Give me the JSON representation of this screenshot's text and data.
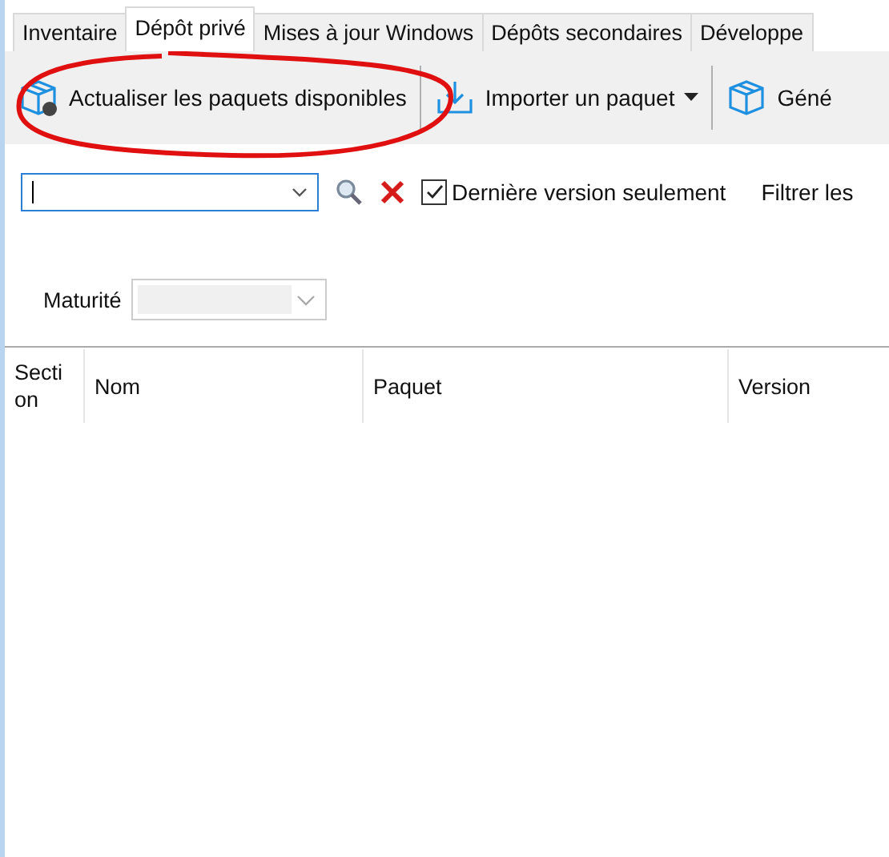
{
  "tabs": [
    {
      "label": "Inventaire",
      "selected": false
    },
    {
      "label": "Dépôt privé",
      "selected": true
    },
    {
      "label": "Mises à jour Windows",
      "selected": false
    },
    {
      "label": "Dépôts secondaires",
      "selected": false
    },
    {
      "label": "Développe",
      "selected": false
    }
  ],
  "toolbar": [
    {
      "kind": "refresh",
      "label": "Actualiser les paquets disponibles",
      "dropdown": false
    },
    {
      "kind": "import",
      "label": "Importer un paquet",
      "dropdown": true
    },
    {
      "kind": "generate",
      "label": "Géné",
      "dropdown": false
    }
  ],
  "filter": {
    "latest_only": {
      "label": "Dernière version seulement",
      "checked": true
    },
    "filter_label": "Filtrer les"
  },
  "maturity": {
    "label": "Maturité",
    "disabled": true
  },
  "table": {
    "columns": [
      "Section",
      "Nom",
      "Paquet",
      "Version"
    ]
  },
  "annotation": {
    "kind": "ellipse"
  }
}
